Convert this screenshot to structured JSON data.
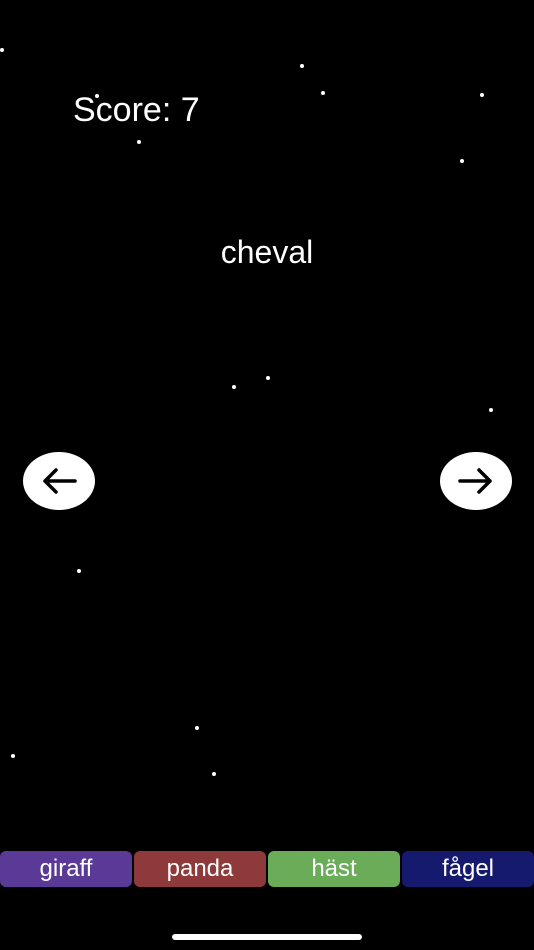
{
  "game": {
    "score_text": "Score: 7",
    "prompt_word": "cheval"
  },
  "navigation": {
    "prev_icon": "arrow-left-icon",
    "next_icon": "arrow-right-icon"
  },
  "choices": [
    {
      "label": "giraff",
      "color": "#5a3a96"
    },
    {
      "label": "panda",
      "color": "#8e3a3a"
    },
    {
      "label": "häst",
      "color": "#6aac58"
    },
    {
      "label": "fågel",
      "color": "#151a6e"
    }
  ],
  "colors": {
    "background": "#000000",
    "text": "#ffffff",
    "star": "#ffffff"
  }
}
